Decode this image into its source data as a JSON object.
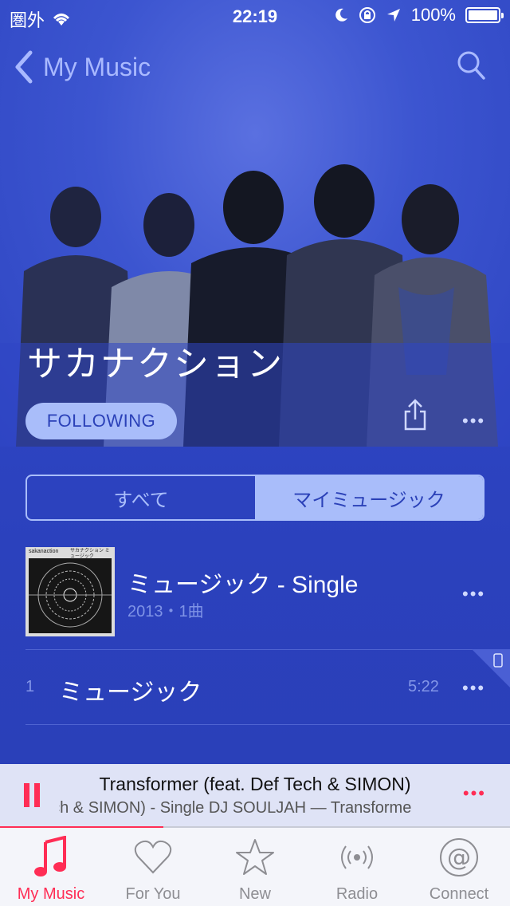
{
  "status_bar": {
    "carrier": "圏外",
    "time": "22:19",
    "battery": "100%"
  },
  "nav": {
    "back_label": "My Music"
  },
  "artist": {
    "name": "サカナクション"
  },
  "follow_button": {
    "label": "FOLLOWING"
  },
  "segments": {
    "all": "すべて",
    "my_music": "マイミュージック",
    "selected": "my_music"
  },
  "album": {
    "title": "ミュージック - Single",
    "subtitle": "2013・1曲",
    "art_text_left": "sakanaction",
    "art_text_right": "サカナクション ミュージック"
  },
  "tracks": [
    {
      "number": "1",
      "title": "ミュージック",
      "duration": "5:22"
    }
  ],
  "now_playing": {
    "title": "Transformer (feat. Def Tech & SIMON)",
    "subtitle": "ech & SIMON) - Single     DJ SOULJAH — Transforme",
    "progress": 0.32
  },
  "tabs": [
    {
      "label": "My Music",
      "icon": "music-note-icon",
      "active": true
    },
    {
      "label": "For You",
      "icon": "heart-icon",
      "active": false
    },
    {
      "label": "New",
      "icon": "star-icon",
      "active": false
    },
    {
      "label": "Radio",
      "icon": "radio-icon",
      "active": false
    },
    {
      "label": "Connect",
      "icon": "at-icon",
      "active": false
    }
  ],
  "colors": {
    "accent": "#ff2d55",
    "background": "#2f46c4",
    "pill": "#a9bdfa"
  }
}
